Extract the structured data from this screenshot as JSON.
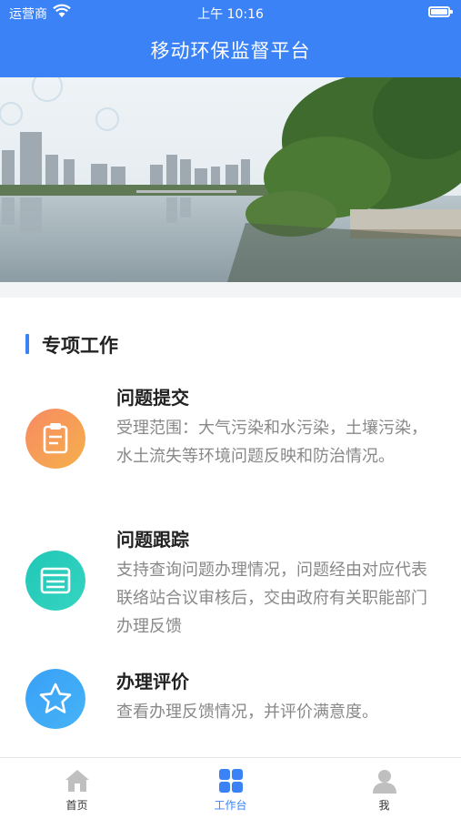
{
  "status_bar": {
    "carrier": "运营商",
    "time": "上午 10:16"
  },
  "header": {
    "title": "移动环保监督平台"
  },
  "section": {
    "title": "专项工作"
  },
  "items": [
    {
      "title": "问题提交",
      "desc": "受理范围：大气污染和水污染，土壤污染，水土流失等环境问题反映和防治情况。",
      "icon": "clipboard-icon"
    },
    {
      "title": "问题跟踪",
      "desc": "支持查询问题办理情况，问题经由对应代表联络站合议审核后，交由政府有关职能部门办理反馈",
      "icon": "browser-window-icon"
    },
    {
      "title": "办理评价",
      "desc": "查看办理反馈情况，并评价满意度。",
      "icon": "star-icon"
    }
  ],
  "tabs": [
    {
      "label": "首页",
      "icon": "home-icon"
    },
    {
      "label": "工作台",
      "icon": "grid-icon"
    },
    {
      "label": "我",
      "icon": "user-icon"
    }
  ],
  "colors": {
    "brand": "#3b82f6",
    "active_tab": "#3b82f6"
  }
}
